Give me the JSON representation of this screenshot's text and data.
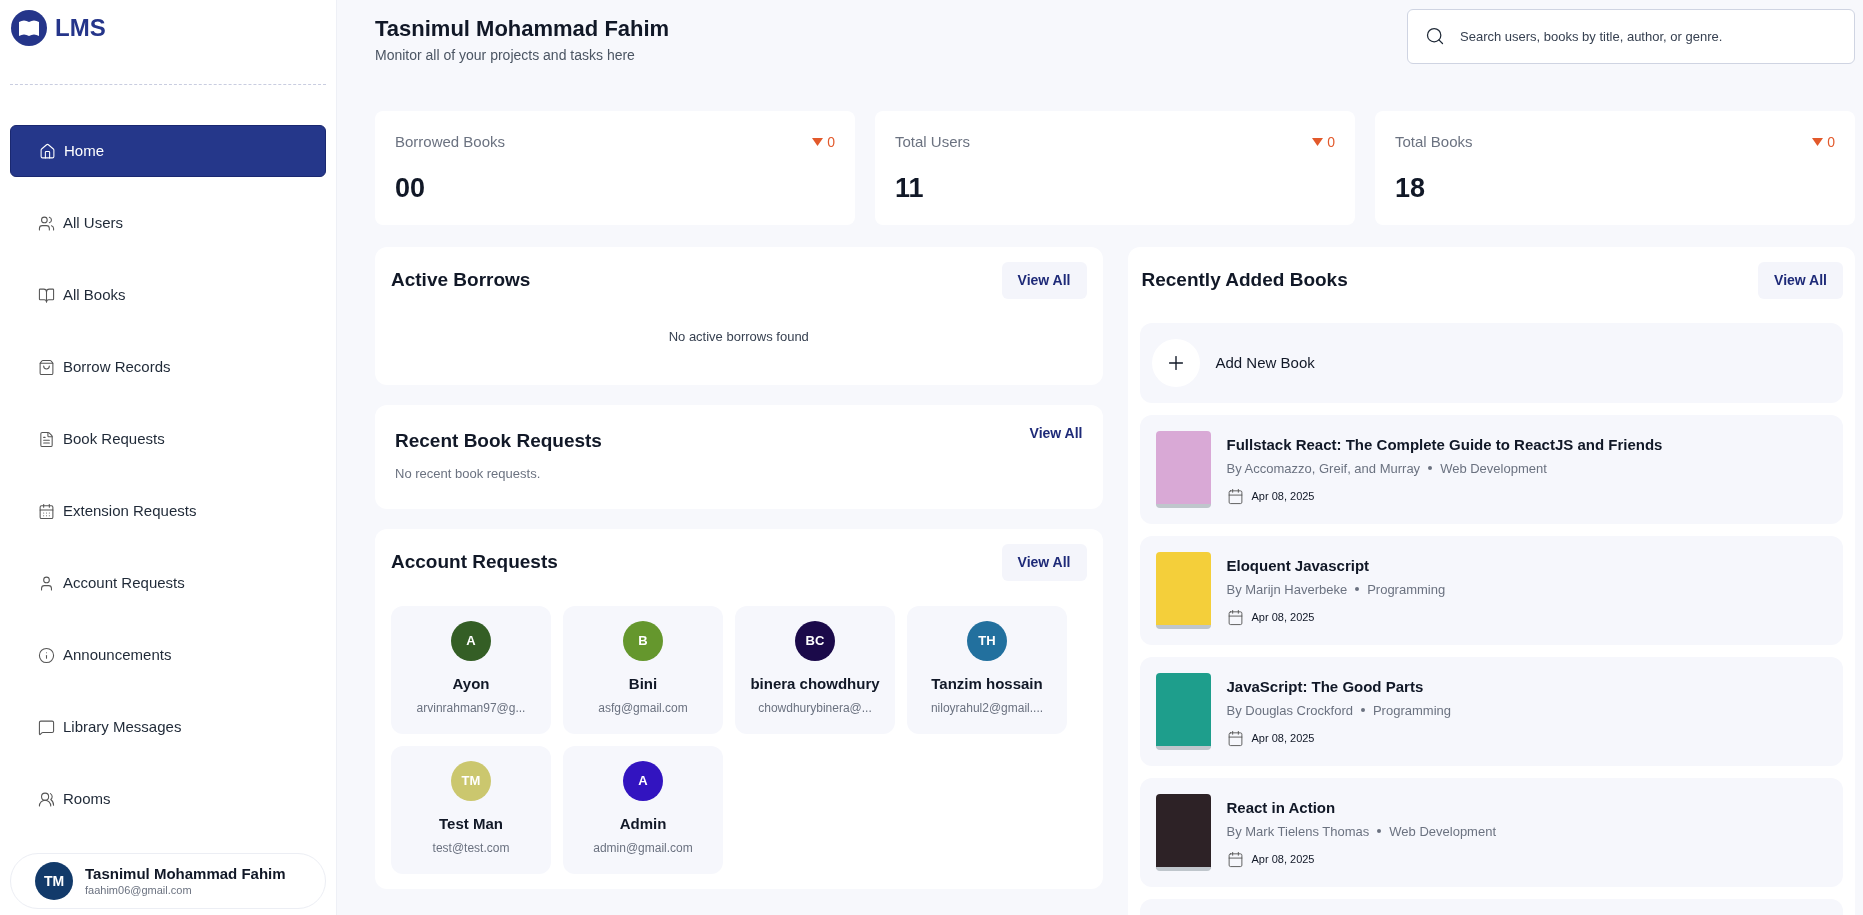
{
  "brand": {
    "name": "LMS"
  },
  "sidebar": {
    "items": [
      {
        "label": "Home",
        "selected": true
      },
      {
        "label": "All Users",
        "selected": false
      },
      {
        "label": "All Books",
        "selected": false
      },
      {
        "label": "Borrow Records",
        "selected": false
      },
      {
        "label": "Book Requests",
        "selected": false
      },
      {
        "label": "Extension Requests",
        "selected": false
      },
      {
        "label": "Account Requests",
        "selected": false
      },
      {
        "label": "Announcements",
        "selected": false
      },
      {
        "label": "Library Messages",
        "selected": false
      },
      {
        "label": "Rooms",
        "selected": false
      }
    ],
    "profile": {
      "initials": "TM",
      "name": "Tasnimul Mohammad Fahim",
      "email": "faahim06@gmail.com"
    }
  },
  "header": {
    "title": "Tasnimul Mohammad Fahim",
    "subtitle": "Monitor all of your projects and tasks here",
    "search": {
      "placeholder": "Search users, books by title, author, or genre."
    }
  },
  "stats": [
    {
      "label": "Borrowed Books",
      "value": "00",
      "trend": "0"
    },
    {
      "label": "Total Users",
      "value": "11",
      "trend": "0"
    },
    {
      "label": "Total Books",
      "value": "18",
      "trend": "0"
    }
  ],
  "active_borrows": {
    "title": "Active Borrows",
    "action": "View All",
    "empty": "No active borrows found"
  },
  "recent_book_requests": {
    "title": "Recent Book Requests",
    "action": "View All",
    "empty": "No recent book requests."
  },
  "account_requests": {
    "title": "Account Requests",
    "action": "View All",
    "users": [
      {
        "initials": "A",
        "name": "Ayon",
        "email": "arvinrahman97@g...",
        "color": "#345e25"
      },
      {
        "initials": "B",
        "name": "Bini",
        "email": "asfg@gmail.com",
        "color": "#65972d"
      },
      {
        "initials": "BC",
        "name": "binera chowdhury",
        "email": "chowdhurybinera@...",
        "color": "#1b0a4a"
      },
      {
        "initials": "TH",
        "name": "Tanzim hossain",
        "email": "niloyrahul2@gmail....",
        "color": "#22709e"
      },
      {
        "initials": "TM",
        "name": "Test Man",
        "email": "test@test.com",
        "color": "#cbc76e"
      },
      {
        "initials": "A",
        "name": "Admin",
        "email": "admin@gmail.com",
        "color": "#3214c0"
      }
    ]
  },
  "recently_added_books": {
    "title": "Recently Added Books",
    "action": "View All",
    "add_label": "Add New Book",
    "books": [
      {
        "title": "Fullstack React: The Complete Guide to ReactJS and Friends",
        "author": "By Accomazzo, Greif, and Murray",
        "genre": "Web Development",
        "date": "Apr 08, 2025",
        "color": "#d9a9d6"
      },
      {
        "title": "Eloquent Javascript",
        "author": "By Marijn Haverbeke",
        "genre": "Programming",
        "date": "Apr 08, 2025",
        "color": "#f4cf3a"
      },
      {
        "title": "JavaScript: The Good Parts",
        "author": "By Douglas Crockford",
        "genre": "Programming",
        "date": "Apr 08, 2025",
        "color": "#1e9e8c"
      },
      {
        "title": "React in Action",
        "author": "By Mark Tielens Thomas",
        "genre": "Web Development",
        "date": "Apr 08, 2025",
        "color": "#2d2226"
      }
    ]
  }
}
